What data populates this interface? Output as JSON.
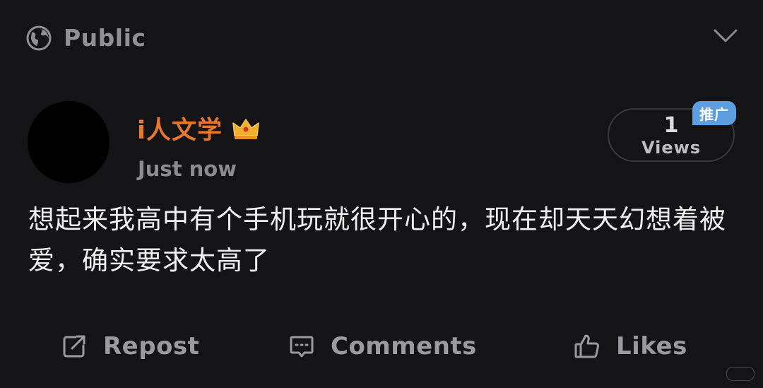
{
  "header": {
    "visibility_label": "Public",
    "visibility_icon": "globe-icon",
    "collapse_icon": "chevron-down-icon"
  },
  "post": {
    "author_name": "i人文学",
    "author_badge_icon": "crown-icon",
    "timestamp": "Just now",
    "text": "想起来我高中有个手机玩就很开心的，现在却天天幻想着被爱，确实要求太高了"
  },
  "views": {
    "count": "1",
    "label": "Views",
    "promo_badge": "推广"
  },
  "actions": {
    "repost_label": "Repost",
    "comments_label": "Comments",
    "likes_label": "Likes"
  },
  "colors": {
    "background": "#141416",
    "author_accent": "#e8782f",
    "promo_badge": "#5c9ee0",
    "muted": "#9a9a9f"
  }
}
